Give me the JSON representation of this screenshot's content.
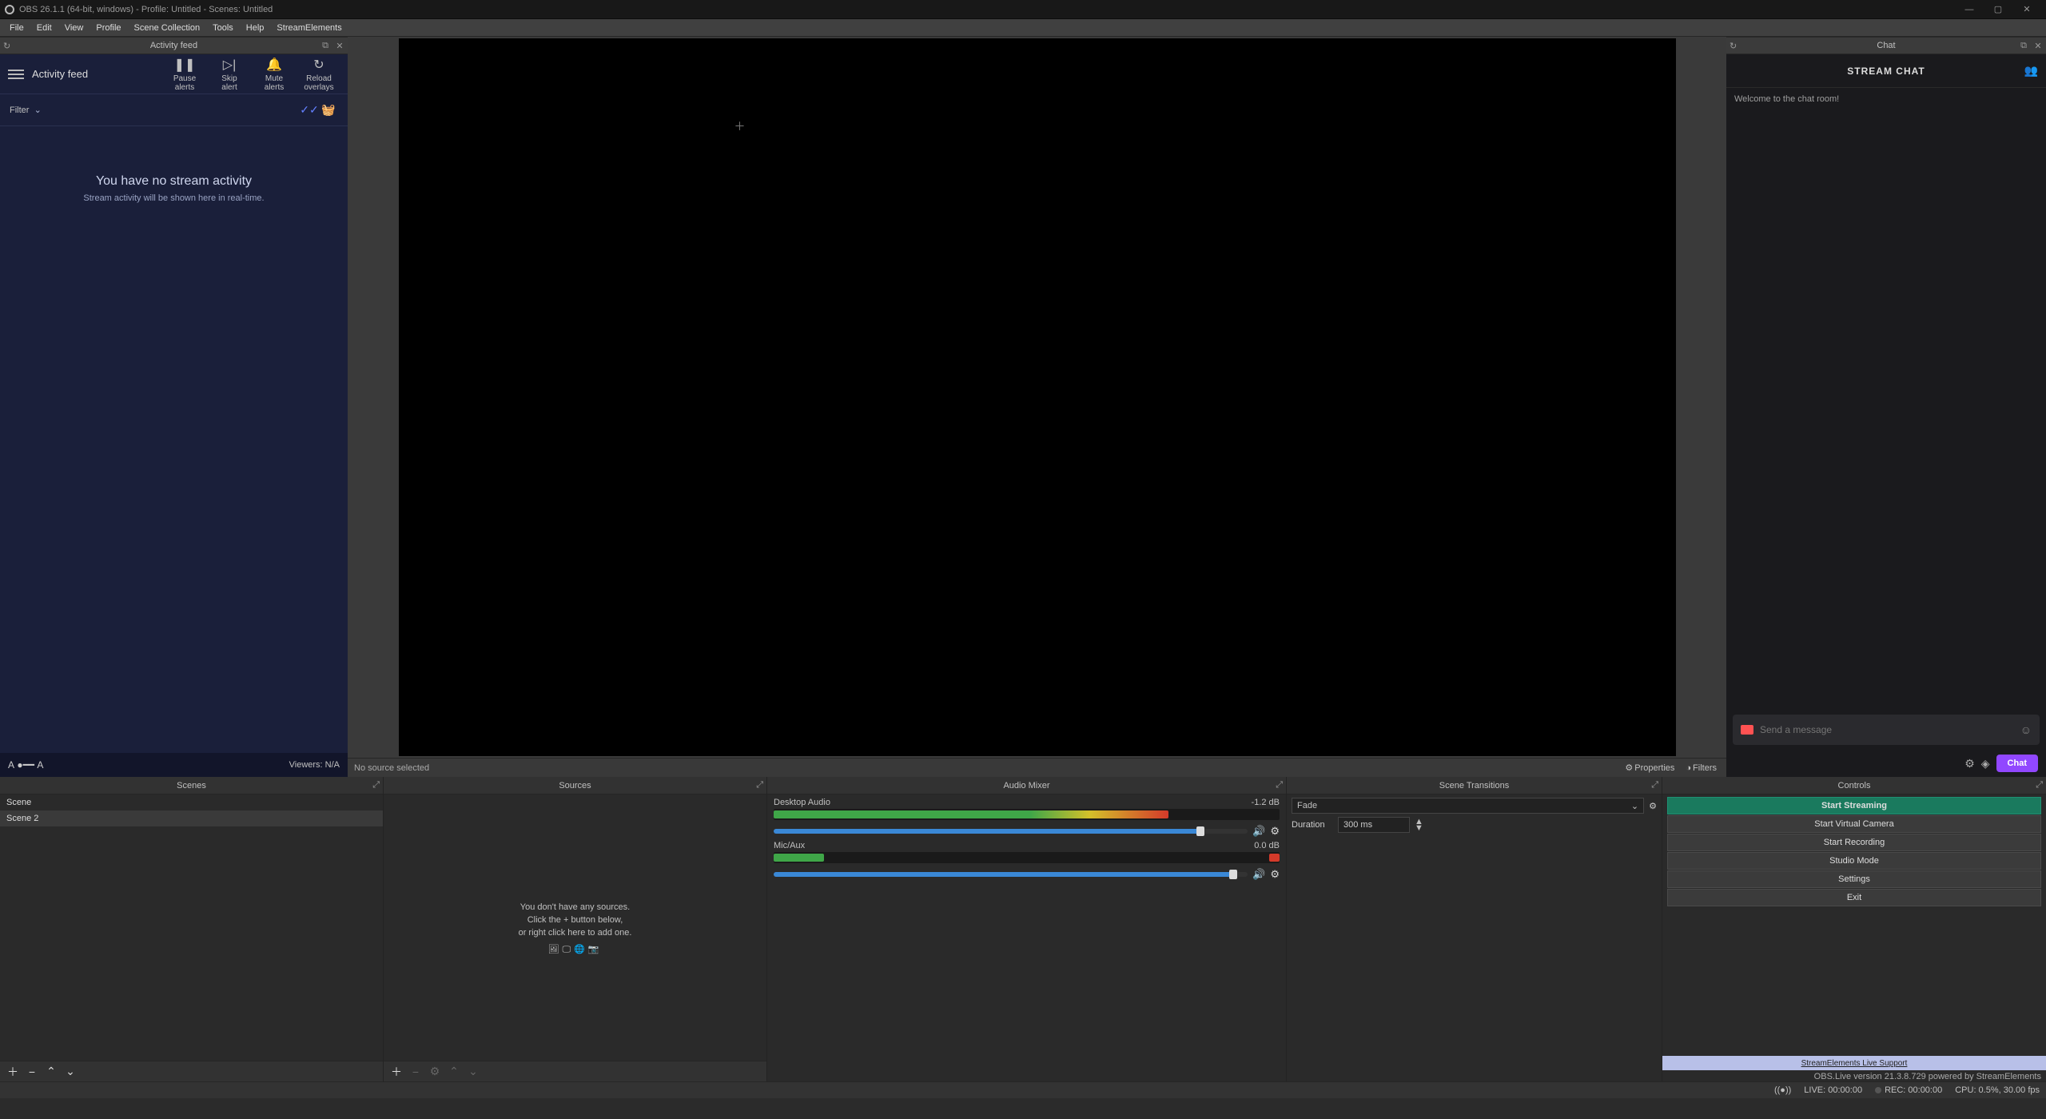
{
  "window": {
    "title": "OBS 26.1.1 (64-bit, windows) - Profile: Untitled - Scenes: Untitled"
  },
  "menus": [
    "File",
    "Edit",
    "View",
    "Profile",
    "Scene Collection",
    "Tools",
    "Help",
    "StreamElements"
  ],
  "docks": {
    "activity_title": "Activity feed",
    "chat_title": "Chat"
  },
  "activity": {
    "panel_title": "Activity feed",
    "btn_pause": "Pause\nalerts",
    "btn_skip": "Skip\nalert",
    "btn_mute": "Mute\nalerts",
    "btn_reload": "Reload\noverlays",
    "filter_label": "Filter",
    "empty_title": "You have no stream activity",
    "empty_sub": "Stream activity will be shown here in real-time.",
    "viewers": "Viewers: N/A"
  },
  "chat": {
    "title": "STREAM CHAT",
    "welcome": "Welcome to the chat room!",
    "placeholder": "Send a message",
    "chat_button": "Chat"
  },
  "sourcebar": {
    "no_source": "No source selected",
    "properties": "Properties",
    "filters": "Filters"
  },
  "panels": {
    "scenes": "Scenes",
    "sources": "Sources",
    "mixer": "Audio Mixer",
    "transitions": "Scene Transitions",
    "controls": "Controls"
  },
  "scenes": [
    "Scene",
    "Scene 2"
  ],
  "sources_empty": {
    "l1": "You don't have any sources.",
    "l2": "Click the + button below,",
    "l3": "or right click here to add one."
  },
  "mixer": {
    "track1": {
      "name": "Desktop Audio",
      "db": "-1.2 dB",
      "fill": 90
    },
    "track2": {
      "name": "Mic/Aux",
      "db": "0.0 dB",
      "fill": 97
    }
  },
  "transitions": {
    "combo": "Fade",
    "duration_label": "Duration",
    "duration_value": "300 ms"
  },
  "controls": {
    "start_stream": "Start Streaming",
    "start_vcam": "Start Virtual Camera",
    "start_rec": "Start Recording",
    "studio": "Studio Mode",
    "settings": "Settings",
    "exit": "Exit",
    "support_link": "StreamElements Live Support",
    "version": "OBS.Live version 21.3.8.729 powered by StreamElements"
  },
  "status": {
    "live": "LIVE: 00:00:00",
    "rec": "REC: 00:00:00",
    "cpu": "CPU: 0.5%,  30.00 fps"
  }
}
